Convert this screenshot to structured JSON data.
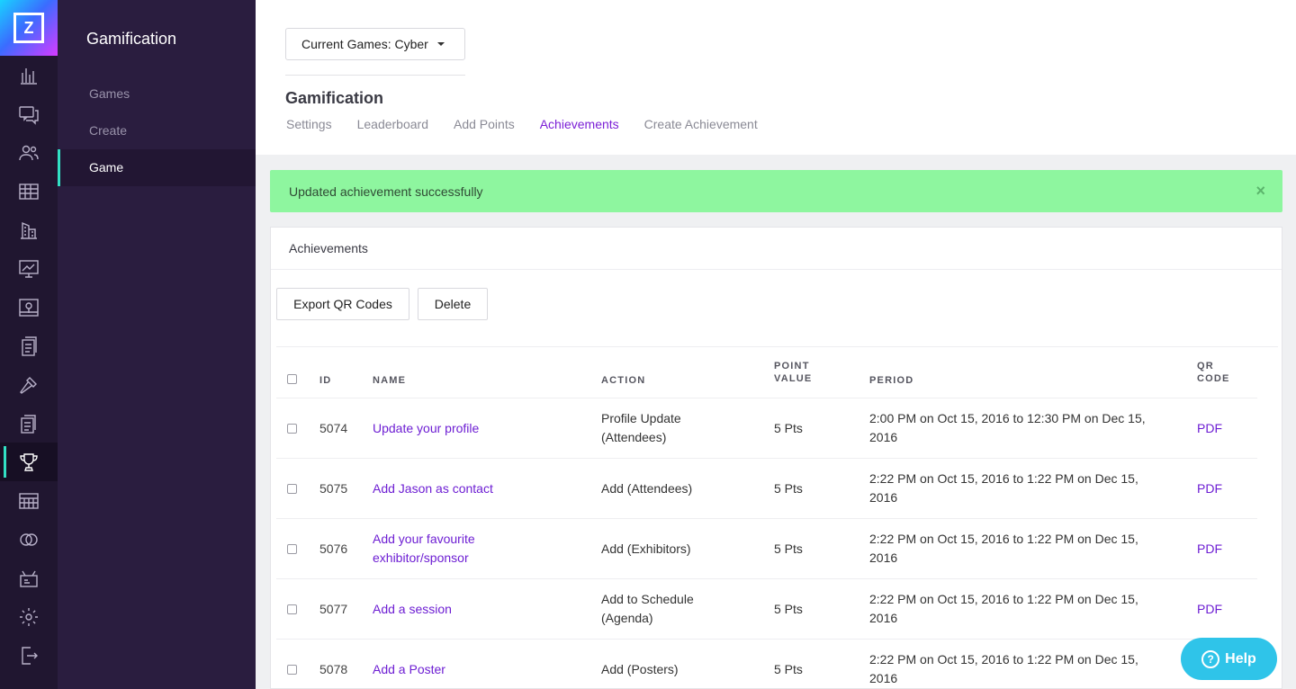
{
  "logo": {
    "letter": "Z"
  },
  "rail": {
    "icons": [
      "bar-chart-icon",
      "chat-icon",
      "people-icon",
      "table-icon",
      "buildings-icon",
      "presentation-icon",
      "map-icon",
      "document-icon",
      "hammer-icon",
      "documents-icon",
      "trophy-icon",
      "calendar-grid-icon",
      "rings-icon",
      "broadcast-icon",
      "gear-icon",
      "exit-icon"
    ],
    "active_index": 10
  },
  "subnav": {
    "title": "Gamification",
    "items": [
      {
        "label": "Games"
      },
      {
        "label": "Create"
      },
      {
        "label": "Game"
      }
    ],
    "active": "Game"
  },
  "header": {
    "games_dropdown": "Current Games: Cyber",
    "section_title": "Gamification",
    "tabs": [
      {
        "label": "Settings"
      },
      {
        "label": "Leaderboard"
      },
      {
        "label": "Add Points"
      },
      {
        "label": "Achievements"
      },
      {
        "label": "Create Achievement"
      }
    ],
    "active_tab": "Achievements"
  },
  "alert": {
    "message": "Updated achievement successfully",
    "close": "×",
    "color": "#8ef69f"
  },
  "card": {
    "title": "Achievements",
    "export_label": "Export QR Codes",
    "delete_label": "Delete"
  },
  "table": {
    "columns": {
      "id": "ID",
      "name": "NAME",
      "action": "ACTION",
      "point_1": "POINT",
      "point_2": "VALUE",
      "period": "PERIOD",
      "qr_1": "QR",
      "qr_2": "CODE"
    },
    "rows": [
      {
        "id": "5074",
        "name": "Update your profile",
        "action": "Profile Update (Attendees)",
        "points": "5 Pts",
        "period": "2:00 PM on Oct 15, 2016 to 12:30 PM on Dec 15, 2016",
        "qr": "PDF"
      },
      {
        "id": "5075",
        "name": "Add Jason as contact",
        "action": "Add (Attendees)",
        "points": "5 Pts",
        "period": "2:22 PM on Oct 15, 2016 to 1:22 PM on Dec 15, 2016",
        "qr": "PDF"
      },
      {
        "id": "5076",
        "name": "Add your favourite exhibitor/sponsor",
        "action": "Add (Exhibitors)",
        "points": "5 Pts",
        "period": "2:22 PM on Oct 15, 2016 to 1:22 PM on Dec 15, 2016",
        "qr": "PDF"
      },
      {
        "id": "5077",
        "name": "Add a session",
        "action": "Add to Schedule (Agenda)",
        "points": "5 Pts",
        "period": "2:22 PM on Oct 15, 2016 to 1:22 PM on Dec 15, 2016",
        "qr": "PDF"
      },
      {
        "id": "5078",
        "name": "Add a Poster",
        "action": "Add (Posters)",
        "points": "5 Pts",
        "period": "2:22 PM on Oct 15, 2016 to 1:22 PM on Dec 15, 2016",
        "qr": "PDF"
      }
    ]
  },
  "help": {
    "label": "Help",
    "icon": "question-icon"
  },
  "colors": {
    "accent": "#7b1fd6",
    "rail_bg": "#201630",
    "subnav_bg": "#2a1d3f",
    "active_marker": "#32e0c4",
    "help_bg": "#2fc4e9"
  }
}
